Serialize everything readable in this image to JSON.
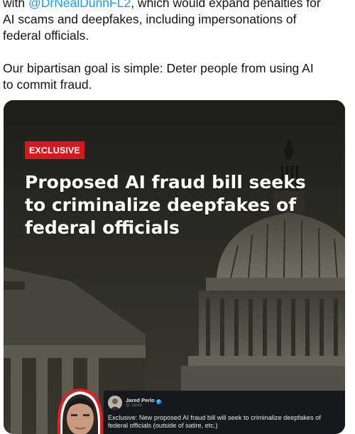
{
  "tweet": {
    "para1": {
      "line1_prefix": "with ",
      "line1_mention": "@DrNealDunnFL2",
      "line1_suffix": ", which would expand penalties for",
      "line2": "AI scams and deepfakes, including impersonations of",
      "line3": "federal officials."
    },
    "para2": {
      "line1": "Our bipartisan goal is simple: Deter people from using AI",
      "line2": "to commit fraud."
    },
    "mention_color": "#1d9bf0"
  },
  "card": {
    "badge": "EXCLUSIVE",
    "badge_color": "#d8181f",
    "headline_lines": [
      "Proposed AI fraud bill seeks",
      "to criminalize deepfakes of",
      "federal officials"
    ],
    "inset_tweet": {
      "author": "Jared Perlo",
      "handle": "@ Jared",
      "text_line1": "Exclusive: New proposed AI fraud bill will seek to criminalize deepfakes of",
      "text_line2": "federal officials (outside of satire, etc.)",
      "verified_icon": "verified-badge-icon"
    },
    "photo_outline_color": "#e0201c"
  }
}
